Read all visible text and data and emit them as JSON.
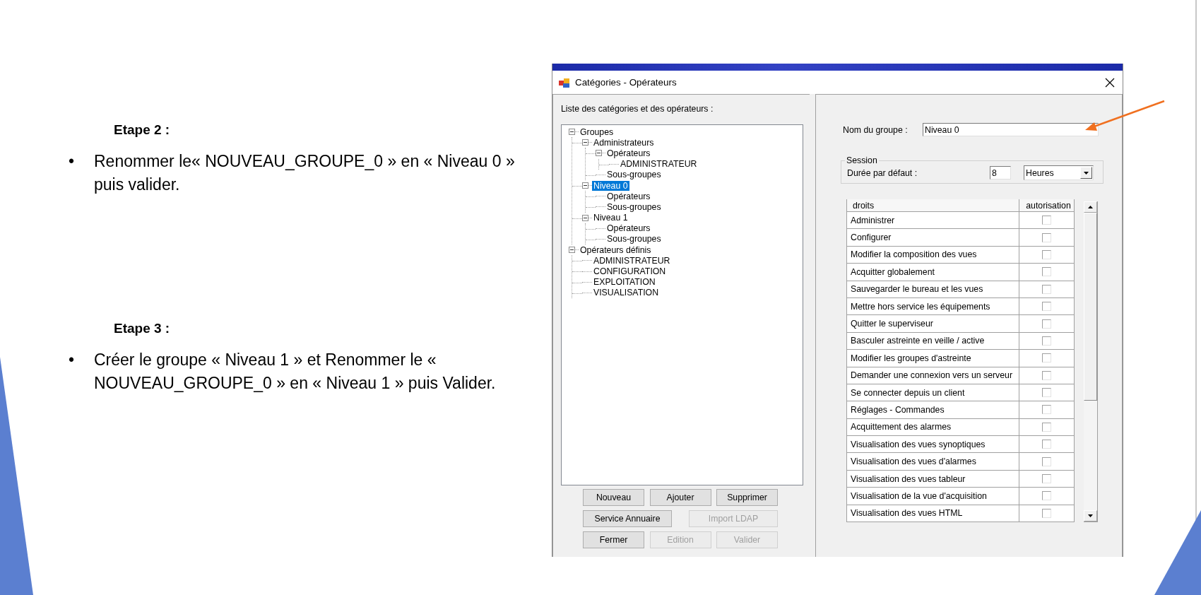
{
  "slide": {
    "steps": [
      {
        "heading": "Etape 2 :",
        "bullet": "•",
        "text": "Renommer le« NOUVEAU_GROUPE_0 » en « Niveau 0 » puis valider."
      },
      {
        "heading": "Etape 3 :",
        "bullet": "•",
        "text": "Créer le groupe « Niveau 1 » et Renommer le « NOUVEAU_GROUPE_0 » en « Niveau 1 » puis Valider."
      }
    ]
  },
  "window": {
    "title": "Catégories - Opérateurs"
  },
  "tree": {
    "label": "Liste des catégories et des opérateurs :",
    "items": [
      {
        "label": "Groupes",
        "selected": false,
        "expanded": true,
        "children": [
          {
            "label": "Administrateurs",
            "selected": false,
            "expanded": true,
            "children": [
              {
                "label": "Opérateurs",
                "selected": false,
                "expanded": true,
                "children": [
                  {
                    "label": "ADMINISTRATEUR",
                    "selected": false
                  }
                ]
              },
              {
                "label": "Sous-groupes",
                "selected": false
              }
            ]
          },
          {
            "label": "Niveau 0",
            "selected": true,
            "expanded": true,
            "children": [
              {
                "label": "Opérateurs",
                "selected": false
              },
              {
                "label": "Sous-groupes",
                "selected": false
              }
            ]
          },
          {
            "label": "Niveau 1",
            "selected": false,
            "expanded": true,
            "children": [
              {
                "label": "Opérateurs",
                "selected": false
              },
              {
                "label": "Sous-groupes",
                "selected": false
              }
            ]
          }
        ]
      },
      {
        "label": "Opérateurs définis",
        "selected": false,
        "expanded": true,
        "children": [
          {
            "label": "ADMINISTRATEUR",
            "selected": false
          },
          {
            "label": "CONFIGURATION",
            "selected": false
          },
          {
            "label": "EXPLOITATION",
            "selected": false
          },
          {
            "label": "VISUALISATION",
            "selected": false
          }
        ]
      }
    ]
  },
  "buttons": [
    [
      {
        "label": "Nouveau",
        "disabled": false
      },
      {
        "label": "Ajouter",
        "disabled": false
      },
      {
        "label": "Supprimer",
        "disabled": false
      }
    ],
    [
      {
        "label": "Service Annuaire",
        "disabled": false
      },
      {
        "label": "Import LDAP",
        "disabled": true
      }
    ],
    [
      {
        "label": "Fermer",
        "disabled": false
      },
      {
        "label": "Edition",
        "disabled": true
      },
      {
        "label": "Valider",
        "disabled": true
      }
    ]
  ],
  "group_name": {
    "label": "Nom du groupe :",
    "value": "Niveau 0"
  },
  "session": {
    "legend": "Session",
    "label": "Durée par défaut :",
    "duration": "8",
    "unit": "Heures"
  },
  "rights_table": {
    "columns": [
      "droits",
      "autorisation"
    ],
    "rows": [
      {
        "name": "Administrer",
        "checked": false
      },
      {
        "name": "Configurer",
        "checked": false
      },
      {
        "name": "Modifier la composition des vues",
        "checked": false
      },
      {
        "name": "Acquitter globalement",
        "checked": false
      },
      {
        "name": "Sauvegarder le bureau et les vues",
        "checked": false
      },
      {
        "name": "Mettre hors service les équipements",
        "checked": false
      },
      {
        "name": "Quitter le superviseur",
        "checked": false
      },
      {
        "name": "Basculer astreinte en veille / active",
        "checked": false
      },
      {
        "name": "Modifier les groupes d'astreinte",
        "checked": false
      },
      {
        "name": "Demander une connexion vers un serveur",
        "checked": false
      },
      {
        "name": "Se connecter depuis un client",
        "checked": false
      },
      {
        "name": "Réglages - Commandes",
        "checked": false
      },
      {
        "name": "Acquittement des alarmes",
        "checked": false
      },
      {
        "name": "Visualisation des vues synoptiques",
        "checked": false
      },
      {
        "name": "Visualisation des vues d'alarmes",
        "checked": false
      },
      {
        "name": "Visualisation des vues tableur",
        "checked": false
      },
      {
        "name": "Visualisation de la vue d'acquisition",
        "checked": false
      },
      {
        "name": "Visualisation des vues HTML",
        "checked": false
      }
    ]
  }
}
